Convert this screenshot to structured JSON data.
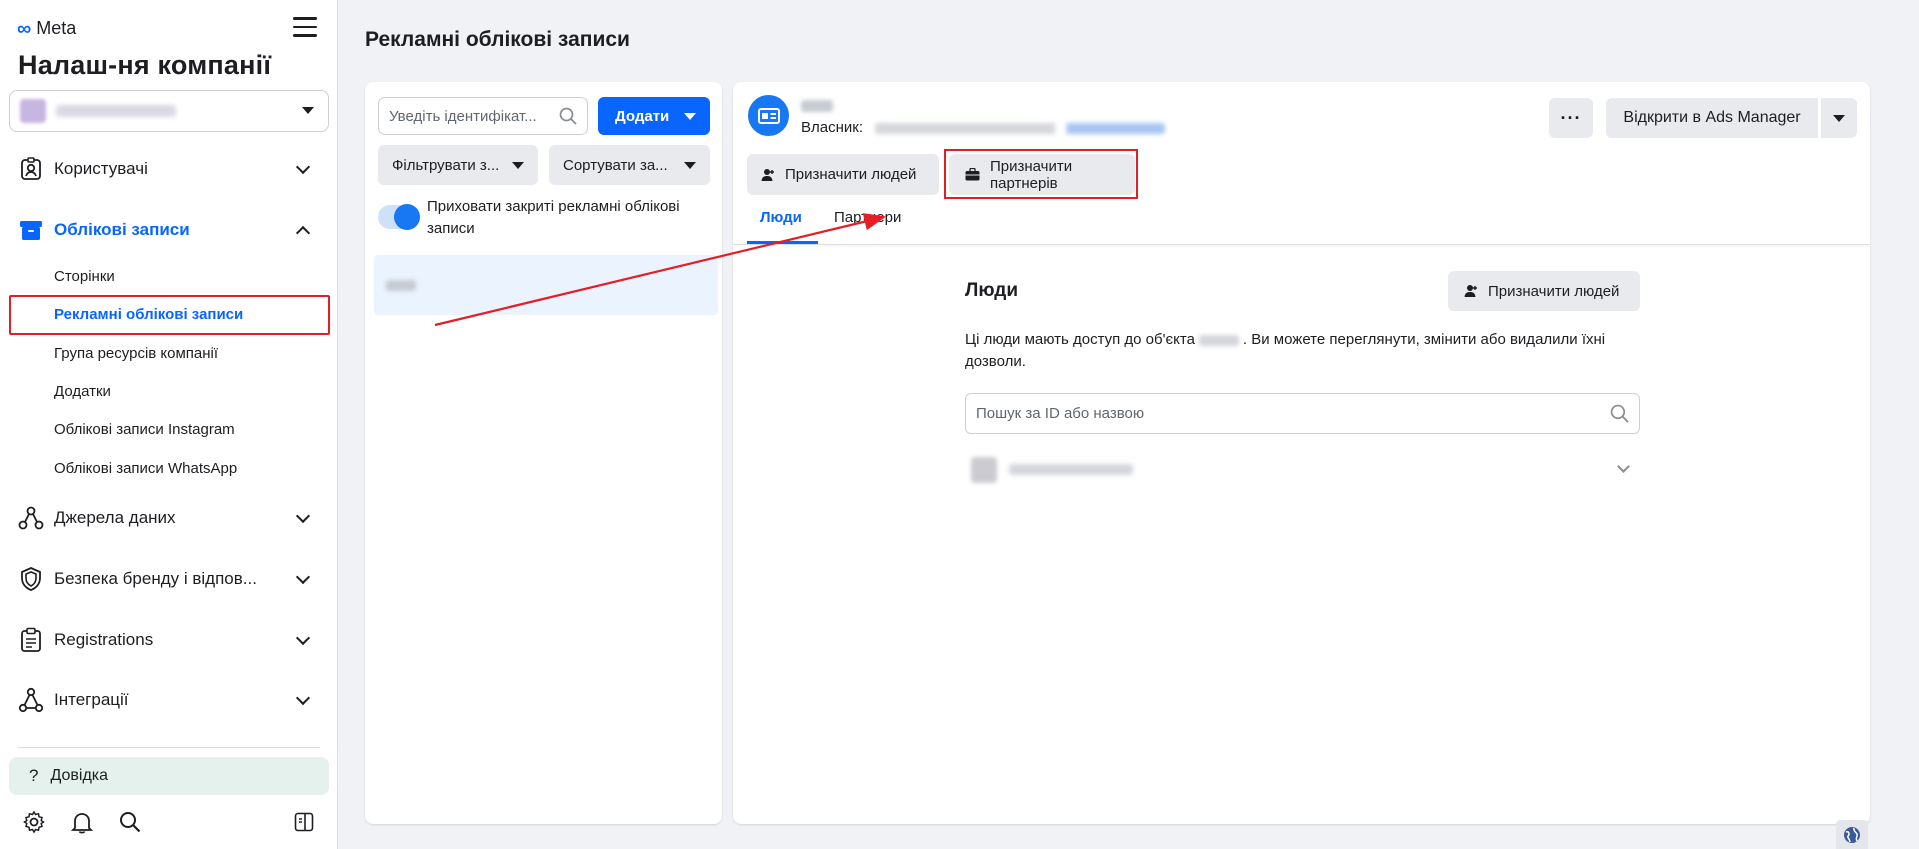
{
  "brand": {
    "logo_text": "Meta"
  },
  "sidebar": {
    "company_title": "Налаш-ня компанії",
    "sections": {
      "users": "Користувачі",
      "accounts": "Облікові записи",
      "data_sources": "Джерела даних",
      "brand_safety": "Безпека бренду і відпов...",
      "registrations": "Registrations",
      "integrations": "Інтеграції"
    },
    "sub_items": {
      "pages": "Сторінки",
      "ad_accounts": "Рекламні облікові записи",
      "asset_group": "Група ресурсів компанії",
      "apps": "Додатки",
      "instagram": "Облікові записи Instagram",
      "whatsapp": "Облікові записи WhatsApp"
    },
    "help_label": "Довідка",
    "help_glyph": "?"
  },
  "main": {
    "page_title": "Рекламні облікові записи",
    "list": {
      "search_placeholder": "Уведіть ідентифікат...",
      "add_label": "Додати",
      "filter_label": "Фільтрувати з...",
      "sort_label": "Сортувати за...",
      "toggle_label": "Приховати закриті рекламні облікові записи",
      "toggle_on": true
    },
    "detail": {
      "owner_label": "Власник:",
      "more_label": "···",
      "open_ads_manager": "Відкрити в Ads Manager",
      "assign_people": "Призначити людей",
      "assign_partners": "Призначити партнерів",
      "tabs": {
        "people": "Люди",
        "partners": "Партнери"
      },
      "people_title": "Люди",
      "people_assign_btn": "Призначити людей",
      "people_desc_before": "Ці люди мають доступ до об'єкта",
      "people_desc_after": ". Ви можете переглянути, змінити або видалили їхні дозволи.",
      "people_search_placeholder": "Пошук за ID або назвою"
    }
  },
  "colors": {
    "accent": "#0866ff",
    "highlight": "#e41e26"
  }
}
